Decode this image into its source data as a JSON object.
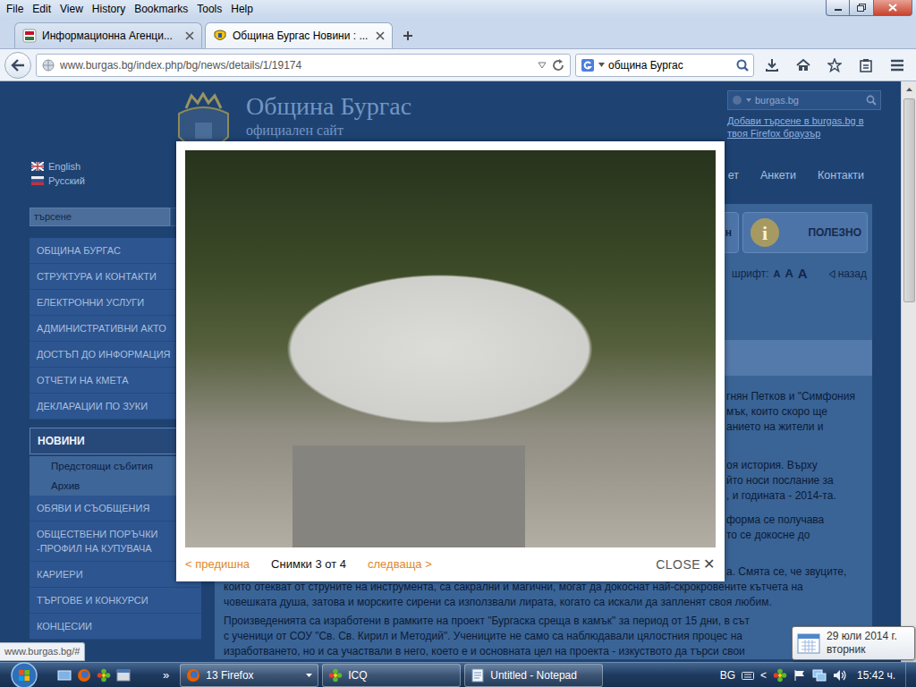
{
  "menu": [
    "File",
    "Edit",
    "View",
    "History",
    "Bookmarks",
    "Tools",
    "Help"
  ],
  "tabs": [
    {
      "label": "Информационна Агенци...",
      "selected": false
    },
    {
      "label": "Община Бургас Новини : ...",
      "selected": true
    }
  ],
  "address_bar": {
    "url": "www.burgas.bg/index.php/bg/news/details/1/19174"
  },
  "search_bar": {
    "value": "община Бургас"
  },
  "site": {
    "title": "Община Бургас",
    "subtitle": "официален сайт",
    "header_search": {
      "placeholder": "burgas.bg"
    },
    "add_search_link": "Добави търсене в burgas.bg в твоя Firefox браузър",
    "languages": [
      "English",
      "Русский"
    ],
    "sidebar_search": {
      "placeholder": "търсене"
    },
    "sidebar": [
      {
        "label": "ОБЩИНА БУРГАС",
        "kind": "main",
        "selected": false
      },
      {
        "label": "СТРУКТУРА И КОНТАКТИ",
        "kind": "main",
        "selected": false
      },
      {
        "label": "ЕЛЕКТРОННИ УСЛУГИ",
        "kind": "main",
        "selected": false
      },
      {
        "label": "АДМИНИСТРАТИВНИ АКТО",
        "kind": "main",
        "selected": false
      },
      {
        "label": "ДОСТЪП ДО ИНФОРМАЦИЯ",
        "kind": "main",
        "selected": false
      },
      {
        "label": "ОТЧЕТИ НА КМЕТА",
        "kind": "main",
        "selected": false
      },
      {
        "label": "ДЕКЛАРАЦИИ ПО ЗУКИ",
        "kind": "main",
        "selected": false
      },
      {
        "label": "НОВИНИ",
        "kind": "main",
        "selected": true
      },
      {
        "label": "Предстоящи събития",
        "kind": "sub",
        "selected": false
      },
      {
        "label": "Архив",
        "kind": "sub",
        "selected": false
      },
      {
        "label": "ОБЯВИ И СЪОБЩЕНИЯ",
        "kind": "main",
        "selected": false
      },
      {
        "label": "ОБЩЕСТВЕНИ ПОРЪЧКИ -ПРОФИЛ НА КУПУВАЧА",
        "kind": "main",
        "selected": false
      },
      {
        "label": "КАРИЕРИ",
        "kind": "main",
        "selected": false
      },
      {
        "label": "ТЪРГОВЕ И КОНКУРСИ",
        "kind": "main",
        "selected": false
      },
      {
        "label": "КОНЦЕСИИ",
        "kind": "main",
        "selected": false
      }
    ],
    "top_nav": [
      "ет",
      "Анкети",
      "Контакти"
    ],
    "quick_links": [
      {
        "label": "н"
      },
      {
        "label": "ПОЛЕЗНО",
        "icon": "i"
      }
    ],
    "font_label": "шрифт:",
    "font_sizes": [
      "A",
      "A",
      "A"
    ],
    "back_link": "назад",
    "article": [
      [
        {
          "text": "гнян Петков и \"Симфония",
          "kind": "fragment"
        },
        {
          "text": "мък, които скоро ще",
          "kind": "fragment"
        },
        {
          "text": "анието на жители и",
          "kind": "fragment"
        }
      ],
      [
        {
          "text": "оя история. Върху",
          "kind": "fragment"
        },
        {
          "text": "йто носи послание за",
          "kind": "fragment"
        },
        {
          "text": ", и годината - 2014-та.",
          "kind": "fragment"
        }
      ],
      [
        {
          "text": "форма се получава",
          "kind": "fragment"
        },
        {
          "text": "то се докосне до",
          "kind": "fragment"
        }
      ],
      [
        {
          "text": "а. Смята се, че звуците,",
          "kind": "fragment"
        },
        {
          "text": "които отекват от струните на инструмента, са сакрални и магични, могат да докоснат най-скрокровените кътчета на",
          "kind": "full"
        },
        {
          "text": "човешката душа, затова и морските сирени са използвали лирата, когато са искали да запленят своя любим.",
          "kind": "full"
        }
      ],
      [
        {
          "text": "Произведенията са изработени в рамките на проект \"Бургаска среща в камък\" за период от 15 дни, в сът",
          "kind": "full"
        },
        {
          "text": "с ученици от СОУ \"Св. Св. Кирил и Методий\". Учениците не само са наблюдавали цялостния процес на",
          "kind": "full"
        },
        {
          "text": "изработването, но и са участвали в него, което е и основната цел на проекта - изкуството да търси свои",
          "kind": "full"
        }
      ]
    ]
  },
  "status_link": "www.burgas.bg/#",
  "lightbox": {
    "prev": "< предишна",
    "counter": "Снимки 3 от 4",
    "next": "следваща >",
    "close": "CLOSE",
    "close_icon": "✕"
  },
  "taskbar": {
    "more": "»",
    "buttons": [
      {
        "label": "13 Firefox",
        "kind": "firefox"
      },
      {
        "label": "ICQ",
        "kind": "icq"
      },
      {
        "label": "Untitled - Notepad",
        "kind": "notepad"
      }
    ],
    "language": "BG",
    "tray_toggle": "<",
    "clock": "15:42 ч."
  },
  "clock_tooltip": {
    "date": "29 юли 2014 г.",
    "weekday": "вторник"
  }
}
